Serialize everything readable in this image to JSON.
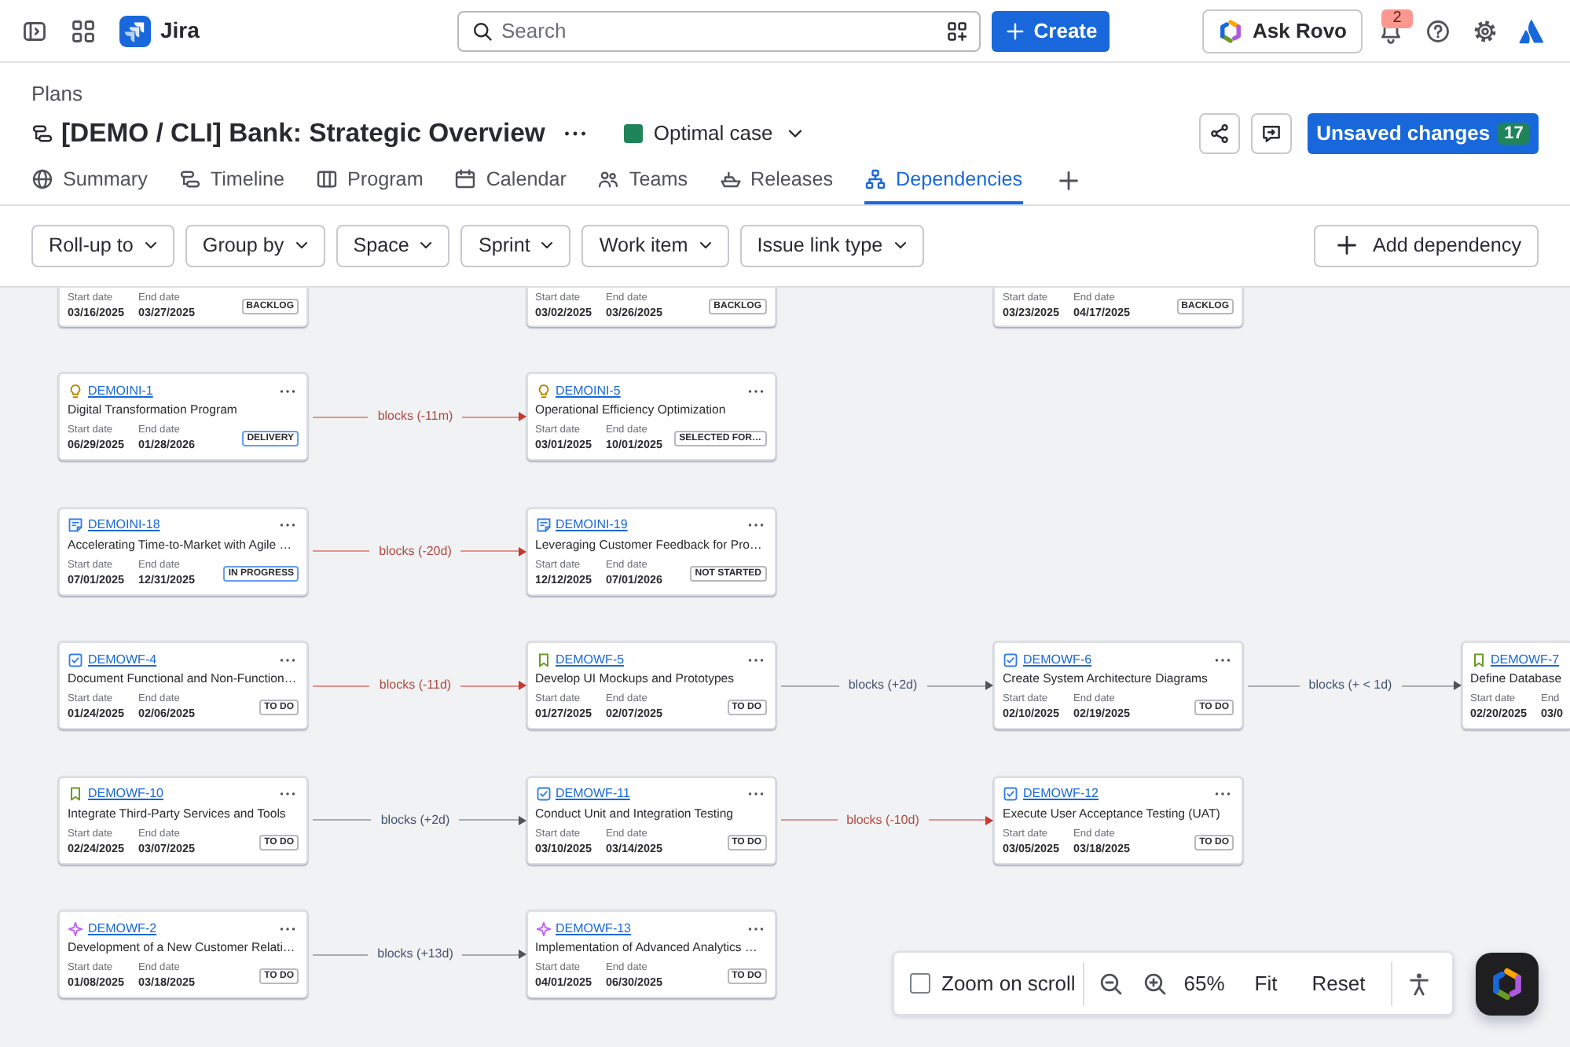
{
  "topbar": {
    "product": "Jira",
    "search": {
      "placeholder": "Search"
    },
    "create_button": "Create",
    "ask_rovo_button": "Ask Rovo",
    "notification_count": "2"
  },
  "header": {
    "breadcrumb": "Plans",
    "title": "[DEMO / CLI] Bank: Strategic Overview",
    "scenario": {
      "label": "Optimal case",
      "color": "#1f845a"
    },
    "unsaved_button": {
      "label": "Unsaved changes",
      "count": "17"
    }
  },
  "tabs": [
    {
      "kind": "summary",
      "label": "Summary",
      "selected": false
    },
    {
      "kind": "timeline",
      "label": "Timeline",
      "selected": false
    },
    {
      "kind": "program",
      "label": "Program",
      "selected": false
    },
    {
      "kind": "calendar",
      "label": "Calendar",
      "selected": false
    },
    {
      "kind": "teams",
      "label": "Teams",
      "selected": false
    },
    {
      "kind": "releases",
      "label": "Releases",
      "selected": false
    },
    {
      "kind": "dependencies",
      "label": "Dependencies",
      "selected": true
    }
  ],
  "filters": [
    "Roll-up to",
    "Group by",
    "Space",
    "Sprint",
    "Work item",
    "Issue link type"
  ],
  "add_dependency_button": "Add dependency",
  "graph": {
    "rows": [
      {
        "cards": [
          {
            "start_label": "Start date",
            "start": "03/16/2025",
            "end_label": "End date",
            "end": "03/27/2025",
            "status": "BACKLOG",
            "color": "#b7b9be"
          },
          {
            "start_label": "Start date",
            "start": "03/02/2025",
            "end_label": "End date",
            "end": "03/26/2025",
            "status": "BACKLOG",
            "color": "#b7b9be"
          },
          {
            "start_label": "Start date",
            "start": "03/23/2025",
            "end_label": "End date",
            "end": "04/17/2025",
            "status": "BACKLOG",
            "color": "#b7b9be"
          }
        ],
        "links": []
      },
      {
        "cards": [
          {
            "kind": "idea",
            "key": "DEMOINI-1",
            "title": "Digital Transformation Program",
            "start_label": "Start date",
            "start": "06/29/2025",
            "end_label": "End date",
            "end": "01/28/2026",
            "status": "DELIVERY",
            "color": "#669df1"
          },
          {
            "kind": "idea",
            "key": "DEMOINI-5",
            "title": "Operational Efficiency Optimization",
            "start_label": "Start date",
            "start": "03/01/2025",
            "end_label": "End date",
            "end": "10/01/2025",
            "status": "SELECTED FOR…",
            "color": "#b7b9be"
          }
        ],
        "links": [
          {
            "label": "blocks (-11m)",
            "conflict": true
          }
        ]
      },
      {
        "cards": [
          {
            "kind": "initiative",
            "key": "DEMOINI-18",
            "title": "Accelerating Time-to-Market with Agile …",
            "start_label": "Start date",
            "start": "07/01/2025",
            "end_label": "End date",
            "end": "12/31/2025",
            "status": "IN PROGRESS",
            "color": "#669df1"
          },
          {
            "kind": "initiative",
            "key": "DEMOINI-19",
            "title": "Leveraging Customer Feedback for Pro…",
            "start_label": "Start date",
            "start": "12/12/2025",
            "end_label": "End date",
            "end": "07/01/2026",
            "status": "NOT STARTED",
            "color": "#b7b9be"
          }
        ],
        "links": [
          {
            "label": "blocks (-20d)",
            "conflict": true
          }
        ]
      },
      {
        "cards": [
          {
            "kind": "task",
            "key": "DEMOWF-4",
            "title": "Document Functional and Non-Function…",
            "start_label": "Start date",
            "start": "01/24/2025",
            "end_label": "End date",
            "end": "02/06/2025",
            "status": "TO DO",
            "color": "#b7b9be"
          },
          {
            "kind": "story",
            "key": "DEMOWF-5",
            "title": "Develop UI Mockups and Prototypes",
            "start_label": "Start date",
            "start": "01/27/2025",
            "end_label": "End date",
            "end": "02/07/2025",
            "status": "TO DO",
            "color": "#b7b9be"
          },
          {
            "kind": "task",
            "key": "DEMOWF-6",
            "title": "Create System Architecture Diagrams",
            "start_label": "Start date",
            "start": "02/10/2025",
            "end_label": "End date",
            "end": "02/19/2025",
            "status": "TO DO",
            "color": "#b7b9be"
          },
          {
            "kind": "story",
            "key": "DEMOWF-7",
            "title": "Define Database",
            "start_label": "Start date",
            "start": "02/20/2025",
            "end_label": "End",
            "end": "03/0"
          }
        ],
        "links": [
          {
            "label": "blocks (-11d)",
            "conflict": true
          },
          {
            "label": "blocks (+2d)",
            "conflict": false
          },
          {
            "label": "blocks (+ < 1d)",
            "conflict": false
          }
        ]
      },
      {
        "cards": [
          {
            "kind": "story",
            "key": "DEMOWF-10",
            "title": "Integrate Third-Party Services and Tools",
            "start_label": "Start date",
            "start": "02/24/2025",
            "end_label": "End date",
            "end": "03/07/2025",
            "status": "TO DO",
            "color": "#b7b9be"
          },
          {
            "kind": "task",
            "key": "DEMOWF-11",
            "title": "Conduct Unit and Integration Testing",
            "start_label": "Start date",
            "start": "03/10/2025",
            "end_label": "End date",
            "end": "03/14/2025",
            "status": "TO DO",
            "color": "#b7b9be"
          },
          {
            "kind": "task",
            "key": "DEMOWF-12",
            "title": "Execute User Acceptance Testing (UAT)",
            "start_label": "Start date",
            "start": "03/05/2025",
            "end_label": "End date",
            "end": "03/18/2025",
            "status": "TO DO",
            "color": "#b7b9be"
          }
        ],
        "links": [
          {
            "label": "blocks (+2d)",
            "conflict": false
          },
          {
            "label": "blocks (-10d)",
            "conflict": true
          }
        ]
      },
      {
        "cards": [
          {
            "kind": "epic",
            "key": "DEMOWF-2",
            "title": "Development of a New Customer Relati…",
            "start_label": "Start date",
            "start": "01/08/2025",
            "end_label": "End date",
            "end": "03/18/2025",
            "status": "TO DO",
            "color": "#b7b9be"
          },
          {
            "kind": "epic",
            "key": "DEMOWF-13",
            "title": "Implementation of Advanced Analytics …",
            "start_label": "Start date",
            "start": "04/01/2025",
            "end_label": "End date",
            "end": "06/30/2025",
            "status": "TO DO",
            "color": "#b7b9be"
          }
        ],
        "links": [
          {
            "label": "blocks (+13d)",
            "conflict": false
          }
        ]
      }
    ]
  },
  "zoom_controls": {
    "zoom_on_scroll": {
      "label": "Zoom on scroll",
      "checked": false
    },
    "zoom": "65%",
    "fit_button": "Fit",
    "reset_button": "Reset"
  }
}
